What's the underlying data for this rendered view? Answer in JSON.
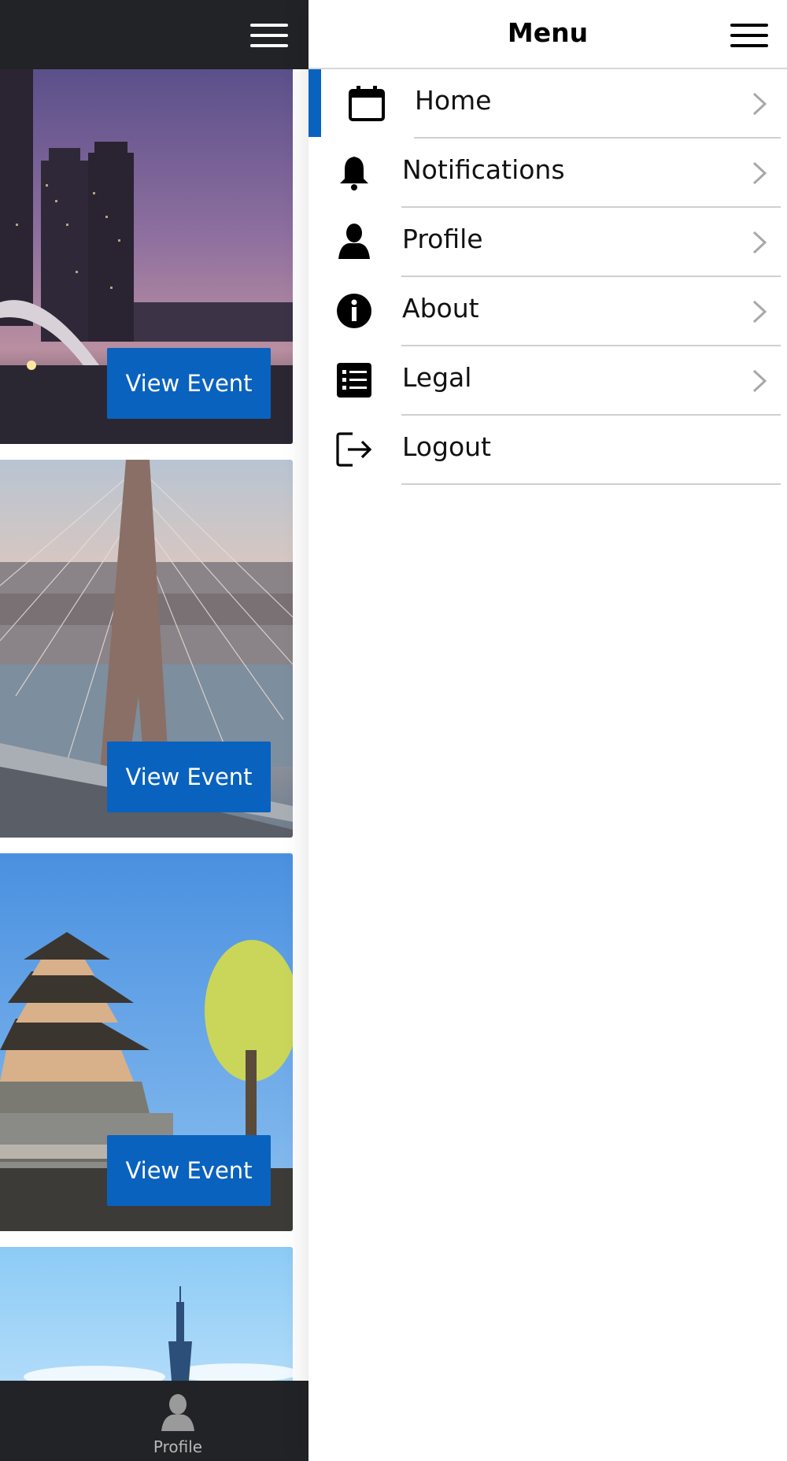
{
  "main": {
    "menu_icon": "hamburger-icon",
    "events": [
      {
        "button_label": "View Event",
        "scene": "city-skyline-at-dusk"
      },
      {
        "button_label": "View Event",
        "scene": "cable-stayed-bridge"
      },
      {
        "button_label": "View Event",
        "scene": "japanese-castle"
      },
      {
        "scene": "taipei-tower-skyline"
      }
    ],
    "bottom_nav": {
      "icon": "person-icon",
      "label": "Profile"
    }
  },
  "drawer": {
    "title": "Menu",
    "menu_icon": "hamburger-icon",
    "accent_color": "#0a62bf",
    "items": [
      {
        "label": "Home",
        "icon": "calendar-icon",
        "active": true,
        "chevron": true
      },
      {
        "label": "Notifications",
        "icon": "bell-icon",
        "active": false,
        "chevron": true
      },
      {
        "label": "Profile",
        "icon": "person-icon",
        "active": false,
        "chevron": true
      },
      {
        "label": "About",
        "icon": "info-icon",
        "active": false,
        "chevron": true
      },
      {
        "label": "Legal",
        "icon": "list-icon",
        "active": false,
        "chevron": true
      },
      {
        "label": "Logout",
        "icon": "logout-icon",
        "active": false,
        "chevron": false
      }
    ]
  }
}
